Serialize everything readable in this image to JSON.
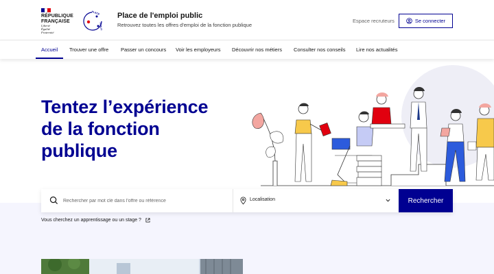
{
  "header": {
    "republic_lines": [
      "RÉPUBLIQUE",
      "FRANÇAISE"
    ],
    "motto_lines": [
      "Liberté",
      "Égalité",
      "Fraternité"
    ],
    "flag_colors": [
      "#000091",
      "#ffffff",
      "#e1000f"
    ],
    "site_logo_icon": "place-emploi-public-logo-icon",
    "site_title": "Place de l'emploi public",
    "site_tagline": "Retrouvez toutes les offres d'emploi de la fonction publique",
    "recruiters_link": "Espace recruteurs",
    "connect_label": "Se connecter",
    "connect_icon": "user-circle-icon"
  },
  "nav": {
    "items": [
      {
        "label": "Accueil",
        "active": true
      },
      {
        "label": "Trouver une offre",
        "active": false
      },
      {
        "label": "Passer un concours",
        "active": false
      },
      {
        "label": "Voir les employeurs",
        "active": false
      },
      {
        "label": "Découvrir nos métiers",
        "active": false
      },
      {
        "label": "Consulter nos conseils",
        "active": false
      },
      {
        "label": "Lire nos actualités",
        "active": false
      }
    ]
  },
  "hero": {
    "headline_lines": [
      "Tentez l’expérience",
      "de la fonction",
      "publique"
    ],
    "illustration_icon": "people-working-illustration-icon"
  },
  "search": {
    "keyword_placeholder": "Rechercher par mot clé dans l'offre ou référence",
    "keyword_value": "",
    "location_label": "Localisation",
    "search_button": "Rechercher"
  },
  "apprenticeship_link": "Vous cherchez un apprentissage ou un stage ?",
  "colors": {
    "brand_blue": "#000091",
    "marianne_red": "#e1000f",
    "light_background": "#f5f5fe"
  }
}
